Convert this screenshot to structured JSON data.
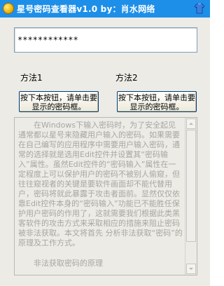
{
  "window": {
    "title": "星号密码查看器v1.0   by：肖水网络"
  },
  "password_field": {
    "value": "************"
  },
  "method1": {
    "label": "方法1",
    "button_label": "按下本按钮，请单击要显示的密码框。"
  },
  "method2": {
    "label": "方法2",
    "button_label": "按下本按钮，请单击要显示的密码框。"
  },
  "description": {
    "paragraph1": "在Windows下输入密码时，为了安全起见通常都以星号来隐藏用户输入的密码。如果需要在自己编写的应用程序中需要用户输入密码，通常的选择就是选用Edit控件并设置其“密码输入”属性。虽然Edit控件的“密码输入”属性在一定程度上可以保护用户的密码不被别人偷窥，但往往窥视者的关键是要软件画面却不能代替用户，密码将就此暴露于攻击者面前。显然仅仅依靠Edit控件本身的“密码输入”功能已不能胜任保护用户密码的作用了，这就需要我们根据此类黑客软件的攻击方式来采取相应的措施来阻止密码被非法获取。本文将首先 分析非法获取“密码”的原理及工作方式。",
    "paragraph2": "非法获取密码的原理"
  },
  "icons": {
    "app_icon": "coin-icon",
    "tshirt_icon": "tshirt-icon"
  },
  "colors": {
    "titlebar": "#1e8fe8",
    "window_bg": "#ecebe6",
    "disabled_text": "#a7a7a2"
  }
}
